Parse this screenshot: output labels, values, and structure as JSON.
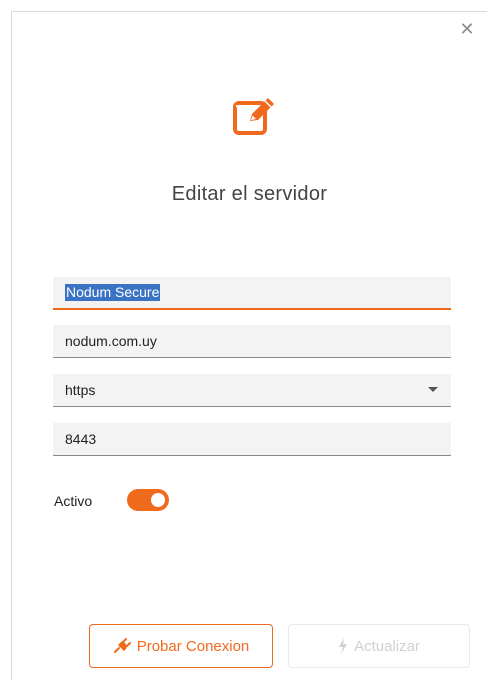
{
  "dialog": {
    "title": "Editar el servidor",
    "close_icon": "close-icon",
    "header_icon": "edit-icon"
  },
  "form": {
    "name_value": "Nodum Secure",
    "host_value": "nodum.com.uy",
    "protocol_value": "https",
    "port_value": "8443",
    "active_label": "Activo",
    "active_on": true
  },
  "buttons": {
    "test_label": "Probar Conexion",
    "test_icon": "plug-icon",
    "update_label": "Actualizar",
    "update_icon": "bolt-icon"
  },
  "colors": {
    "accent": "#f06a1d",
    "selection": "#3b73c4",
    "disabled": "#d0d0d0"
  }
}
